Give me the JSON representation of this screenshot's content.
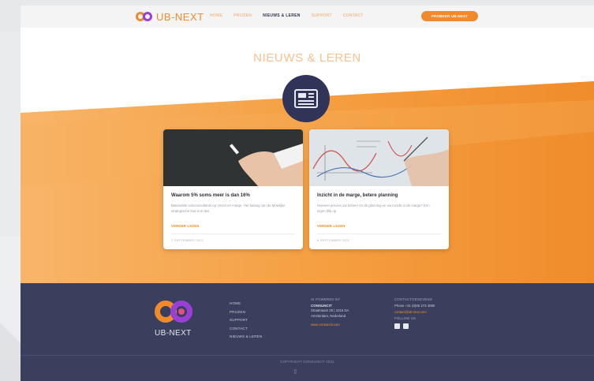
{
  "nav": {
    "logo_text": "UB-NEXT",
    "links": [
      "HOME",
      "PRIJZEN",
      "NIEUWS & LEREN",
      "SUPPORT",
      "CONTACT"
    ],
    "active_index": 2,
    "cta_label": "PROBEER UB-NEXT"
  },
  "page": {
    "title": "NIEUWS & LEREN"
  },
  "cards": [
    {
      "title": "Waarom 5% soms meer is dan 16%",
      "description": "Bekendste soloconsultants op omzet en marge. Het belang van de Moeilijke strategische fout is te dat",
      "more_label": "VERDER LEZEN",
      "date": "7 SEPTEMBER 2021"
    },
    {
      "title": "Inzicht in de marge, betere planning",
      "description": "Hoeveel precies uw beheer en de planning en uw inzicht in de marge? Een eigen blik op",
      "more_label": "VERDER LEZEN",
      "date": "6 SEPTEMBER 2021"
    }
  ],
  "footer": {
    "logo_text": "UB-NEXT",
    "menu": [
      "HOME",
      "PRIJZEN",
      "SUPPORT",
      "CONTACT",
      "NIEUWS & LEREN"
    ],
    "powered_head": "IS POWERED BY",
    "company": "CONSUNCIT",
    "address1": "Straatnaam 26 | 1016 DA",
    "address2": "Amsterdam, Nederland",
    "company_link": "www.consuncit.com",
    "contact_head": "CONTACTGEGEVENS",
    "phone": "Phone +31 (0)85 273 4080",
    "email": "contact@ub-next.com",
    "follow_head": "FOLLOW US",
    "copyright": "COPYRIGHT CONSUNCIT 2021"
  },
  "colors": {
    "accent": "#f08a2c",
    "dark": "#3b3f5e",
    "purple": "#9a3fd6"
  },
  "icons": {
    "news": "newspaper-icon"
  }
}
